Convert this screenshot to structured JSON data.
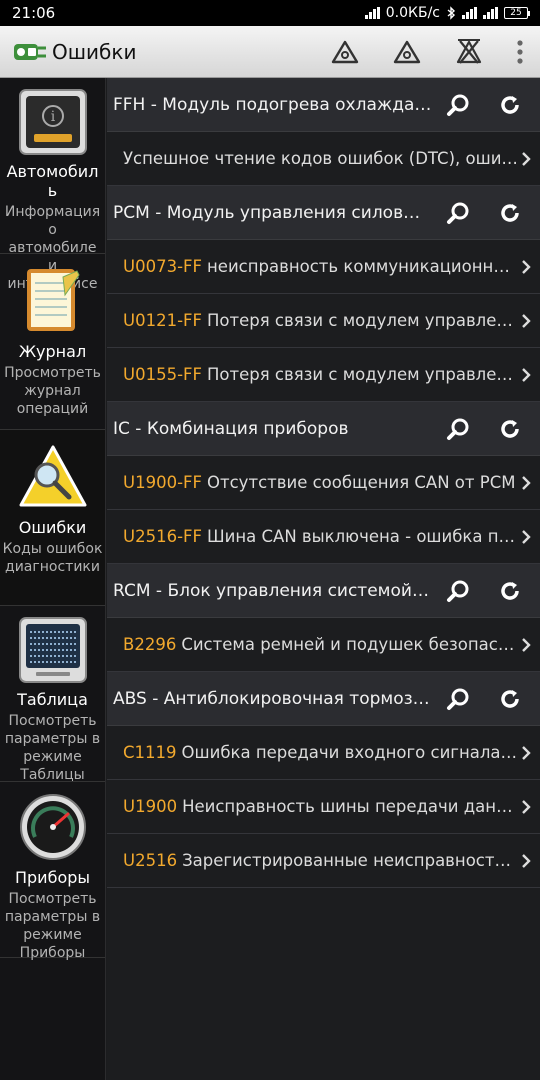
{
  "status": {
    "time": "21:06",
    "net_speed": "0.0КБ/с",
    "battery": "25"
  },
  "appbar": {
    "title": "Ошибки"
  },
  "sidebar": {
    "items": [
      {
        "label": "Автомобиль",
        "desc": "Информация о автомобиле и интерфейсе"
      },
      {
        "label": "Журнал",
        "desc": "Просмотреть журнал операций"
      },
      {
        "label": "Ошибки",
        "desc": "Коды ошибок диагностики"
      },
      {
        "label": "Таблица",
        "desc": "Посмотреть параметры в режиме Таблицы"
      },
      {
        "label": "Приборы",
        "desc": "Посмотреть параметры в режиме Приборы"
      }
    ]
  },
  "modules": [
    {
      "name": "FFH - Модуль подогрева охлаждающей жидкости",
      "rows": [
        {
          "code": "",
          "text": "Успешное чтение кодов ошибок (DTC), ошибок не обнаружено"
        }
      ]
    },
    {
      "name": "PCM - Модуль управления силовым агрегатом",
      "rows": [
        {
          "code": "U0073-FF",
          "text": "неисправность коммуникационной шины"
        },
        {
          "code": "U0121-FF",
          "text": "Потеря связи с модулем управления ABS"
        },
        {
          "code": "U0155-FF",
          "text": "Потеря связи с модулем управления приборов"
        }
      ]
    },
    {
      "name": "IC - Комбинация приборов",
      "rows": [
        {
          "code": "U1900-FF",
          "text": "Отсутствие сообщения CAN от PCM"
        },
        {
          "code": "U2516-FF",
          "text": "Шина CAN выключена - ошибка передачи"
        }
      ]
    },
    {
      "name": "RCM - Блок управления системой безопасности",
      "rows": [
        {
          "code": "B2296",
          "text": "Система ремней и подушек безопасности"
        }
      ]
    },
    {
      "name": "ABS - Антиблокировочная тормозная система",
      "rows": [
        {
          "code": "C1119",
          "text": "Ошибка передачи входного сигнала давления"
        },
        {
          "code": "U1900",
          "text": "Неисправность шины передачи данных"
        },
        {
          "code": "U2516",
          "text": "Зарегистрированные неисправности шины"
        }
      ]
    }
  ]
}
